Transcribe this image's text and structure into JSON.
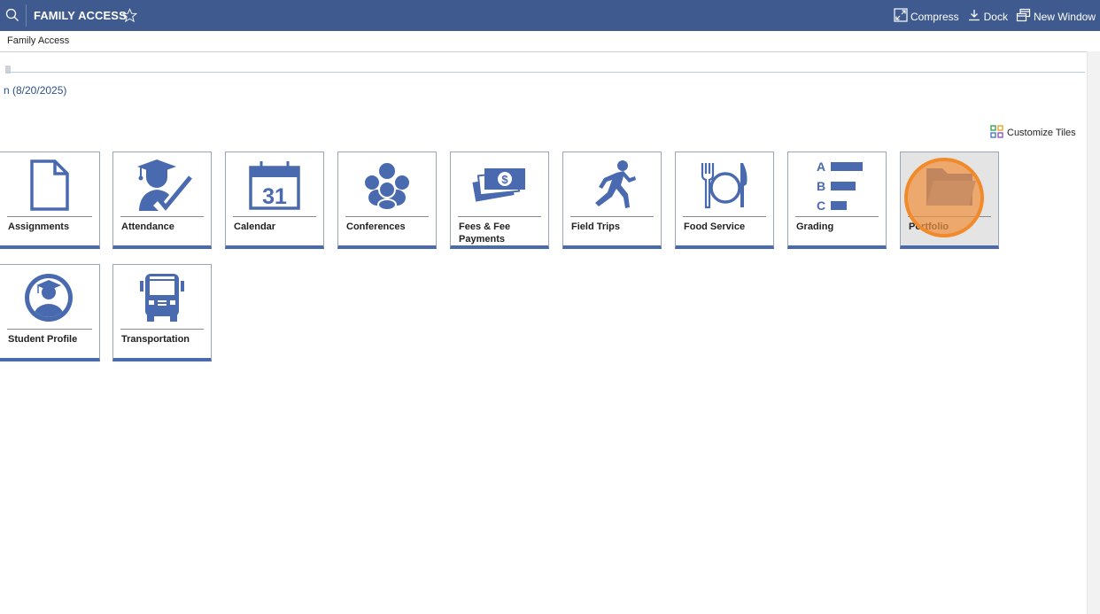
{
  "topbar": {
    "title": "FAMILY ACCESS",
    "search_icon": "search-icon",
    "star_icon": "star-outline-icon",
    "actions": [
      {
        "label": "Compress",
        "icon": "compress-icon"
      },
      {
        "label": "Dock",
        "icon": "dock-icon"
      },
      {
        "label": "New Window",
        "icon": "new-window-icon"
      }
    ]
  },
  "breadcrumb": "Family Access",
  "date_text": "n (8/20/2025)",
  "customize_label": "Customize Tiles",
  "tiles": [
    {
      "label": "Assignments",
      "icon": "document-icon"
    },
    {
      "label": "Attendance",
      "icon": "student-check-icon"
    },
    {
      "label": "Calendar",
      "icon": "calendar-icon",
      "day": "31"
    },
    {
      "label": "Conferences",
      "icon": "people-group-icon"
    },
    {
      "label": "Fees & Fee Payments",
      "icon": "money-icon"
    },
    {
      "label": "Field Trips",
      "icon": "runner-icon"
    },
    {
      "label": "Food Service",
      "icon": "plate-utensils-icon"
    },
    {
      "label": "Grading",
      "icon": "grades-icon",
      "letters": [
        "A",
        "B",
        "C"
      ]
    },
    {
      "label": "Portfolio",
      "icon": "folder-icon"
    },
    {
      "label": "Student Profile",
      "icon": "student-profile-icon"
    },
    {
      "label": "Transportation",
      "icon": "bus-icon"
    }
  ],
  "colors": {
    "header": "#3f5a8f",
    "accent": "#4a6ab0",
    "highlight": "#f08a2a"
  }
}
